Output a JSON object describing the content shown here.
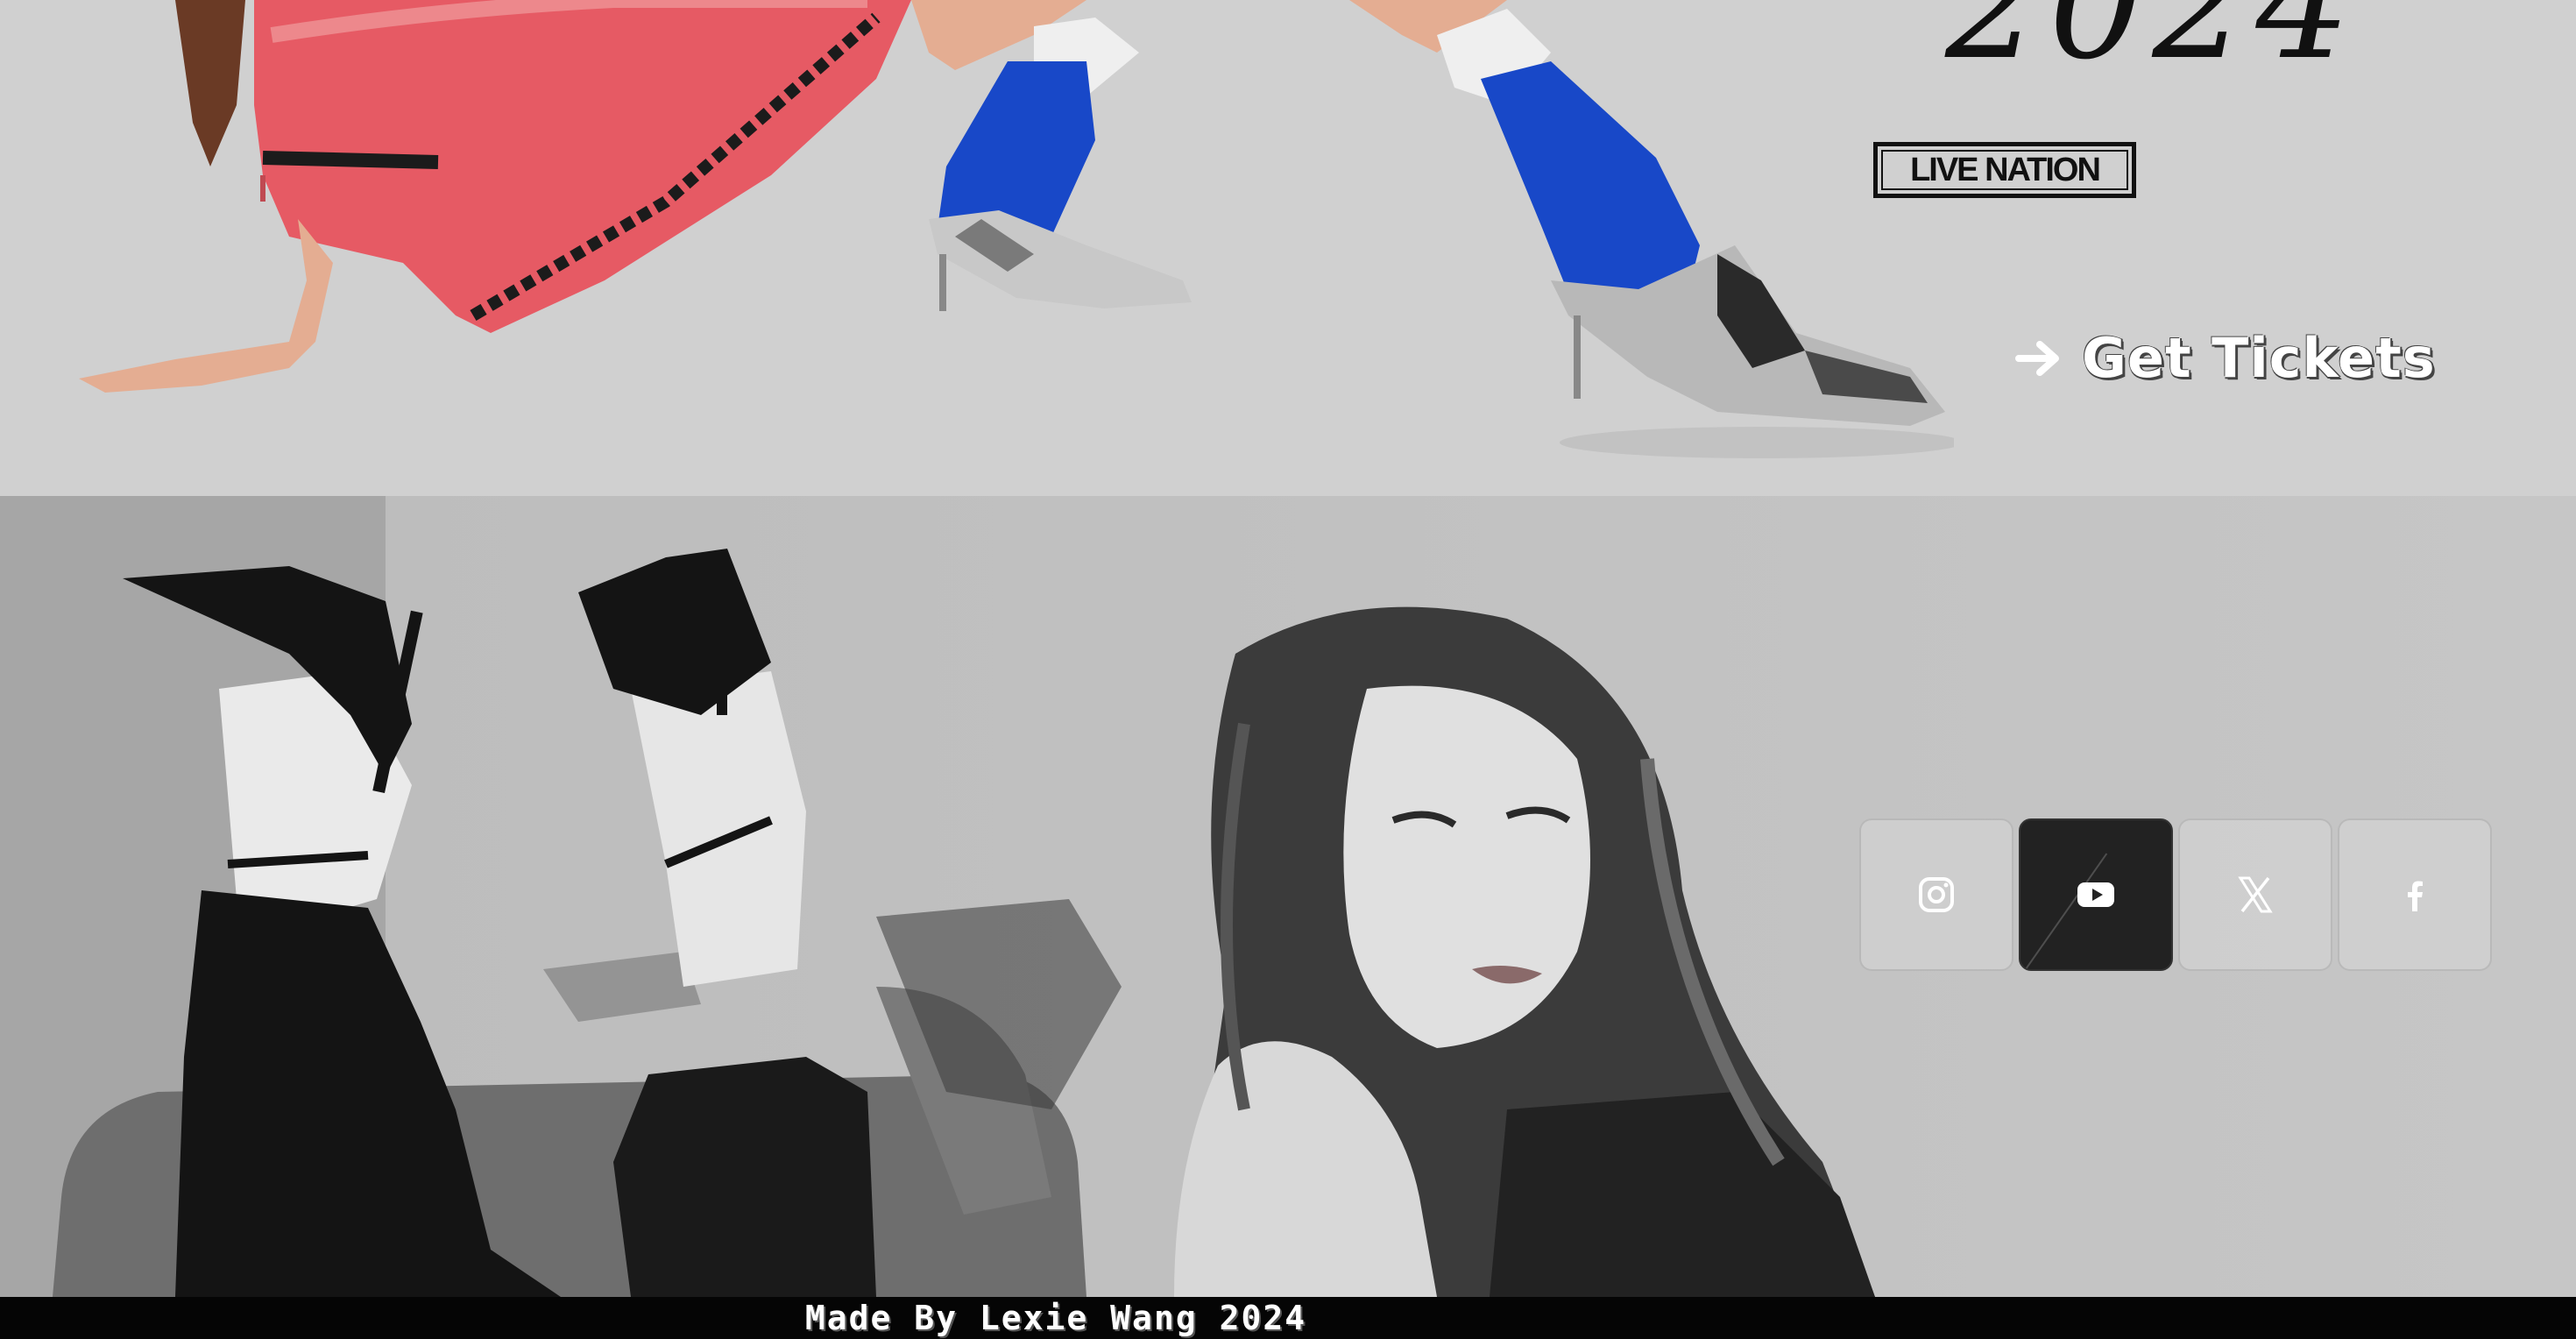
{
  "tour": {
    "year_partial": "2024",
    "promoter_logo": "LIVE NATION",
    "cta_label": "Get Tickets",
    "cta_icon": "arrow-right-icon"
  },
  "social": {
    "links": [
      {
        "name": "Instagram",
        "icon": "instagram-icon",
        "active": false
      },
      {
        "name": "YouTube",
        "icon": "youtube-icon",
        "active": true
      },
      {
        "name": "X",
        "icon": "x-icon",
        "active": false
      },
      {
        "name": "Facebook",
        "icon": "facebook-icon",
        "active": false
      }
    ]
  },
  "footer": {
    "credit": "Made By Lexie Wang 2024"
  },
  "colors": {
    "tour_background": "#d0d0d0",
    "active_tile": "#222222",
    "dress_red": "#e8505a",
    "leg_warmer_blue": "#1848c8"
  }
}
